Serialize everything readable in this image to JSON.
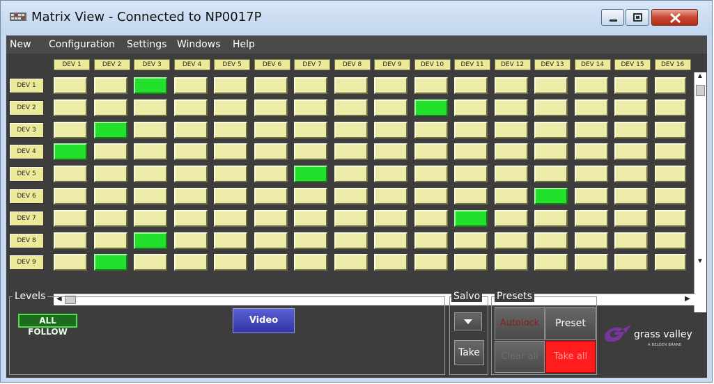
{
  "window": {
    "title": "Matrix View - Connected to NP0017P",
    "buttons": [
      "minimize",
      "maximize",
      "close"
    ]
  },
  "menu": [
    "New",
    "Configuration",
    "Settings",
    "Windows",
    "Help"
  ],
  "matrix": {
    "columns": [
      "DEV 1",
      "DEV 2",
      "DEV 3",
      "DEV 4",
      "DEV 5",
      "DEV 6",
      "DEV 7",
      "DEV 8",
      "DEV 9",
      "DEV 10",
      "DEV 11",
      "DEV 12",
      "DEV 13",
      "DEV 14",
      "DEV 15",
      "DEV 16"
    ],
    "rows": [
      "DEV 1",
      "DEV 2",
      "DEV 3",
      "DEV 4",
      "DEV 5",
      "DEV 6",
      "DEV 7",
      "DEV 8",
      "DEV 9"
    ],
    "active_crosspoints": [
      {
        "row": "DEV 1",
        "column": "DEV 3"
      },
      {
        "row": "DEV 2",
        "column": "DEV 10"
      },
      {
        "row": "DEV 3",
        "column": "DEV 2"
      },
      {
        "row": "DEV 4",
        "column": "DEV 1"
      },
      {
        "row": "DEV 5",
        "column": "DEV 7"
      },
      {
        "row": "DEV 6",
        "column": "DEV 13"
      },
      {
        "row": "DEV 7",
        "column": "DEV 11"
      },
      {
        "row": "DEV 8",
        "column": "DEV 3"
      },
      {
        "row": "DEV 9",
        "column": "DEV 2"
      }
    ]
  },
  "levels": {
    "label": "Levels",
    "all_follow": "ALL FOLLOW",
    "video": "Video"
  },
  "salvo": {
    "label": "Salvo",
    "take": "Take"
  },
  "presets": {
    "label": "Presets",
    "autolock": "Autolock",
    "preset": "Preset",
    "clear_all": "Clear all",
    "take_all": "Take all"
  },
  "logo": {
    "name": "grass valley",
    "tagline": "A BELDEN BRAND"
  },
  "colors": {
    "cell_idle": "#ececa8",
    "cell_active": "#22e02c",
    "background": "#3d3d3d",
    "take_all": "#ff1c1c"
  }
}
